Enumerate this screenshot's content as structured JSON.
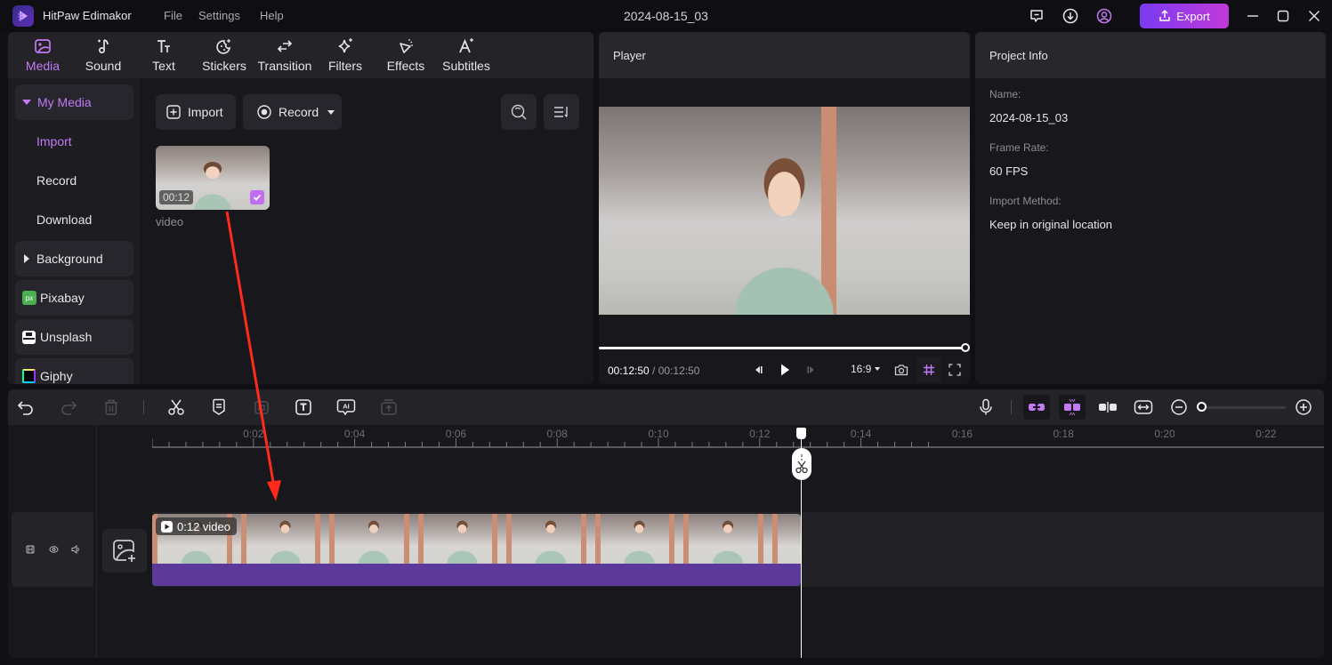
{
  "titlebar": {
    "app_name": "HitPaw Edimakor",
    "menu": [
      "File",
      "Settings",
      "Help"
    ],
    "document_title": "2024-08-15_03",
    "export_label": "Export",
    "icons": [
      "feedback-icon",
      "download-icon",
      "account-icon"
    ]
  },
  "media_tabs": [
    {
      "label": "Media",
      "icon": "media-icon",
      "active": true
    },
    {
      "label": "Sound",
      "icon": "music-note-icon"
    },
    {
      "label": "Text",
      "icon": "text-icon"
    },
    {
      "label": "Stickers",
      "icon": "sticker-icon"
    },
    {
      "label": "Transition",
      "icon": "transition-icon"
    },
    {
      "label": "Filters",
      "icon": "sparkle-icon"
    },
    {
      "label": "Effects",
      "icon": "effects-icon"
    },
    {
      "label": "Subtitles",
      "icon": "subtitles-icon"
    }
  ],
  "sidebar": {
    "my_media": "My Media",
    "sub_items": [
      "Import",
      "Record",
      "Download"
    ],
    "background": "Background",
    "sources": [
      "Pixabay",
      "Unsplash",
      "Giphy"
    ]
  },
  "media_toolbar": {
    "import_label": "Import",
    "record_label": "Record"
  },
  "media_items": [
    {
      "name": "video",
      "duration": "00:12",
      "selected": true
    }
  ],
  "player": {
    "title": "Player",
    "current_time": "00:12:50",
    "total_time": "00:12:50",
    "separator": " / ",
    "aspect_ratio": "16:9",
    "progress_fraction": 1.0
  },
  "project_info": {
    "title": "Project Info",
    "fields": [
      {
        "label": "Name:",
        "value": "2024-08-15_03"
      },
      {
        "label": "Frame Rate:",
        "value": "60 FPS"
      },
      {
        "label": "Import Method:",
        "value": "Keep in original location"
      }
    ]
  },
  "timeline": {
    "ruler_labels": [
      "0:02",
      "0:04",
      "0:06",
      "0:08",
      "0:10",
      "0:12",
      "0:14",
      "0:16",
      "0:18",
      "0:20",
      "0:22"
    ],
    "clip_label": "0:12 video",
    "playhead_time_seconds": 12.8,
    "zoom_fraction": 0.0
  },
  "colors": {
    "accent": "#c27af4",
    "export_gradient_start": "#7a3af2",
    "export_gradient_end": "#c13ad8",
    "clip_bar": "#5b3a99",
    "annotation_arrow": "#ff2a1a"
  }
}
